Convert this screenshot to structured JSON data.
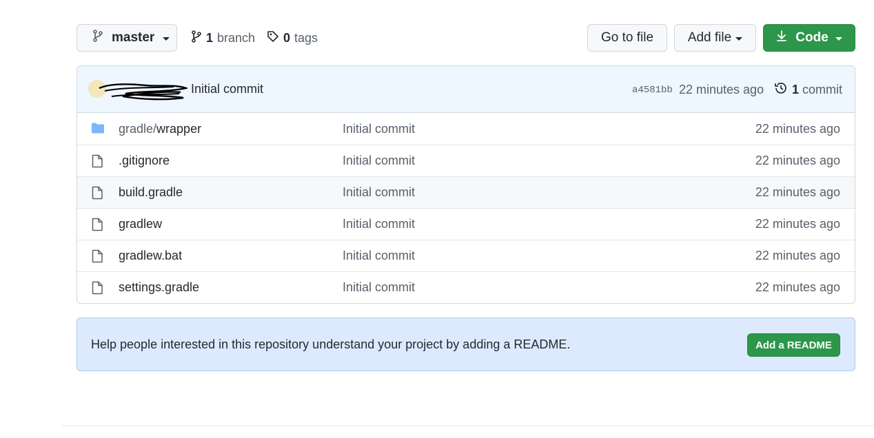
{
  "toolbar": {
    "branch_name": "master",
    "branch_count": "1",
    "branch_word": "branch",
    "tag_count": "0",
    "tag_word": "tags",
    "goto_label": "Go to file",
    "add_file_label": "Add file",
    "code_label": "Code"
  },
  "commit_bar": {
    "message": "Initial commit",
    "sha": "a4581bb",
    "age": "22 minutes ago",
    "commit_count": "1",
    "commit_word": "commit"
  },
  "files": [
    {
      "dir_prefix": "gradle/",
      "name": "wrapper",
      "message": "Initial commit",
      "age": "22 minutes ago",
      "type": "folder"
    },
    {
      "dir_prefix": "",
      "name": ".gitignore",
      "message": "Initial commit",
      "age": "22 minutes ago",
      "type": "file"
    },
    {
      "dir_prefix": "",
      "name": "build.gradle",
      "message": "Initial commit",
      "age": "22 minutes ago",
      "type": "file"
    },
    {
      "dir_prefix": "",
      "name": "gradlew",
      "message": "Initial commit",
      "age": "22 minutes ago",
      "type": "file"
    },
    {
      "dir_prefix": "",
      "name": "gradlew.bat",
      "message": "Initial commit",
      "age": "22 minutes ago",
      "type": "file"
    },
    {
      "dir_prefix": "",
      "name": "settings.gradle",
      "message": "Initial commit",
      "age": "22 minutes ago",
      "type": "file"
    }
  ],
  "readme": {
    "text": "Help people interested in this repository understand your project by adding a README.",
    "button_label": "Add a README"
  },
  "colors": {
    "primary_green": "#2c974b",
    "commit_bar_bg": "#eef6ff",
    "readme_bg": "#ddeafd",
    "folder_blue": "#79b8ff"
  },
  "icons": [
    "git-branch-icon",
    "tag-icon",
    "download-icon",
    "history-icon",
    "folder-icon",
    "file-icon"
  ]
}
